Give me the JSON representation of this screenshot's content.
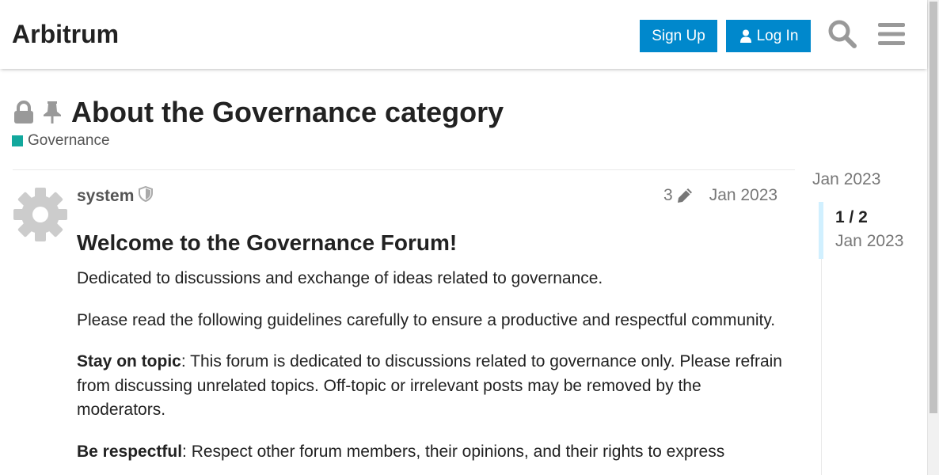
{
  "header": {
    "site_title": "Arbitrum",
    "signup_label": "Sign Up",
    "login_label": "Log In",
    "search_icon": "search-icon",
    "menu_icon": "hamburger-menu-icon"
  },
  "topic": {
    "title": "About the Governance category",
    "status_icons": [
      "lock-icon",
      "pin-icon"
    ],
    "category": {
      "name": "Governance",
      "color": "#12a89d"
    }
  },
  "post": {
    "username": "system",
    "user_badge_icon": "shield-icon",
    "edit_count": "3",
    "date": "Jan 2023",
    "heading": "Welcome to the Governance Forum!",
    "paragraphs": [
      {
        "text": "Dedicated to discussions and exchange of ideas related to governance."
      },
      {
        "text": "Please read the following guidelines carefully to ensure a productive and respectful community."
      },
      {
        "bold": "Stay on topic",
        "text": ": This forum is dedicated to discussions related to governance only. Please refrain from discussing unrelated topics. Off-topic or irrelevant posts may be removed by the moderators."
      },
      {
        "bold": "Be respectful",
        "text": ": Respect other forum members, their opinions, and their rights to express"
      }
    ]
  },
  "timeline": {
    "start_date": "Jan 2023",
    "count": "1 / 2",
    "current_date": "Jan 2023"
  },
  "colors": {
    "accent": "#0088cc",
    "timeline_handle": "#d1f0ff"
  }
}
